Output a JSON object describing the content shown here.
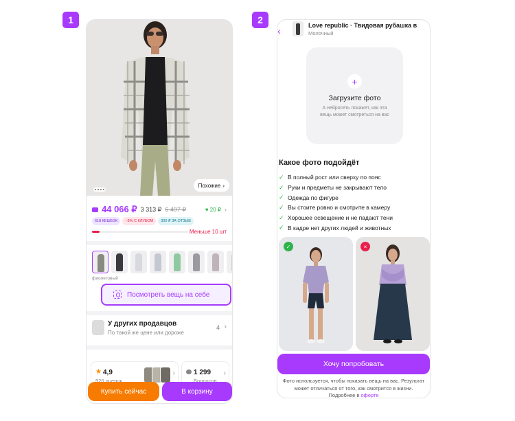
{
  "step_badges": [
    "1",
    "2"
  ],
  "screen1": {
    "similar_label": "Похожие",
    "price_wallet": "44 066 ₽",
    "price_regular": "3 313 ₽",
    "price_old": "6 407 ₽",
    "points": "♥ 20 ₽",
    "chips": [
      "618 КЕШБЭК",
      "−3% С КЛУБОМ",
      "300 ₽ ЗА ОТЗЫВ"
    ],
    "stock_label": "Меньше 10 шт",
    "stock_level": 0.08,
    "color_name": "фиолетовый",
    "try_on_label": "Посмотреть вещь на себе",
    "sellers_title": "У других продавцов",
    "sellers_subtitle": "По такой же цене или дороже",
    "sellers_count": "4",
    "rating_value": "4,9",
    "rating_count": "926 оценок",
    "questions_count": "1 299",
    "questions_label": "Вопросов",
    "buy_now_label": "Купить сейчас",
    "add_to_cart_label": "В корзину",
    "colors": {
      "accent": "#a73afd",
      "orange": "#f77b00",
      "price": "#a73afd"
    }
  },
  "screen2": {
    "product_title": "Love republic · Твидовая рубашка в",
    "product_color": "Молочный",
    "upload_plus": "+",
    "upload_title": "Загрузите фото",
    "upload_desc_1": "А нейросеть покажет, как эта",
    "upload_desc_2": "вещь может смотреться на вас",
    "fit_heading": "Какое фото подойдёт",
    "requirements": [
      "В полный рост или сверху по пояс",
      "Руки и предметы не закрывают тело",
      "Одежда по фигуре",
      "Вы стоите ровно и смотрите в камеру",
      "Хорошее освещение и не падают тени",
      "В кадре нет других людей и животных"
    ],
    "good_mark": "✓",
    "bad_mark": "×",
    "try_button_label": "Хочу попробовать",
    "disclaimer_1": "Фото используется, чтобы показать вещь на вас. Результат",
    "disclaimer_2": "может отличаться от того, как смотрится в жизни.",
    "disclaimer_3": "Подробнее в",
    "disclaimer_link": "оферте"
  }
}
